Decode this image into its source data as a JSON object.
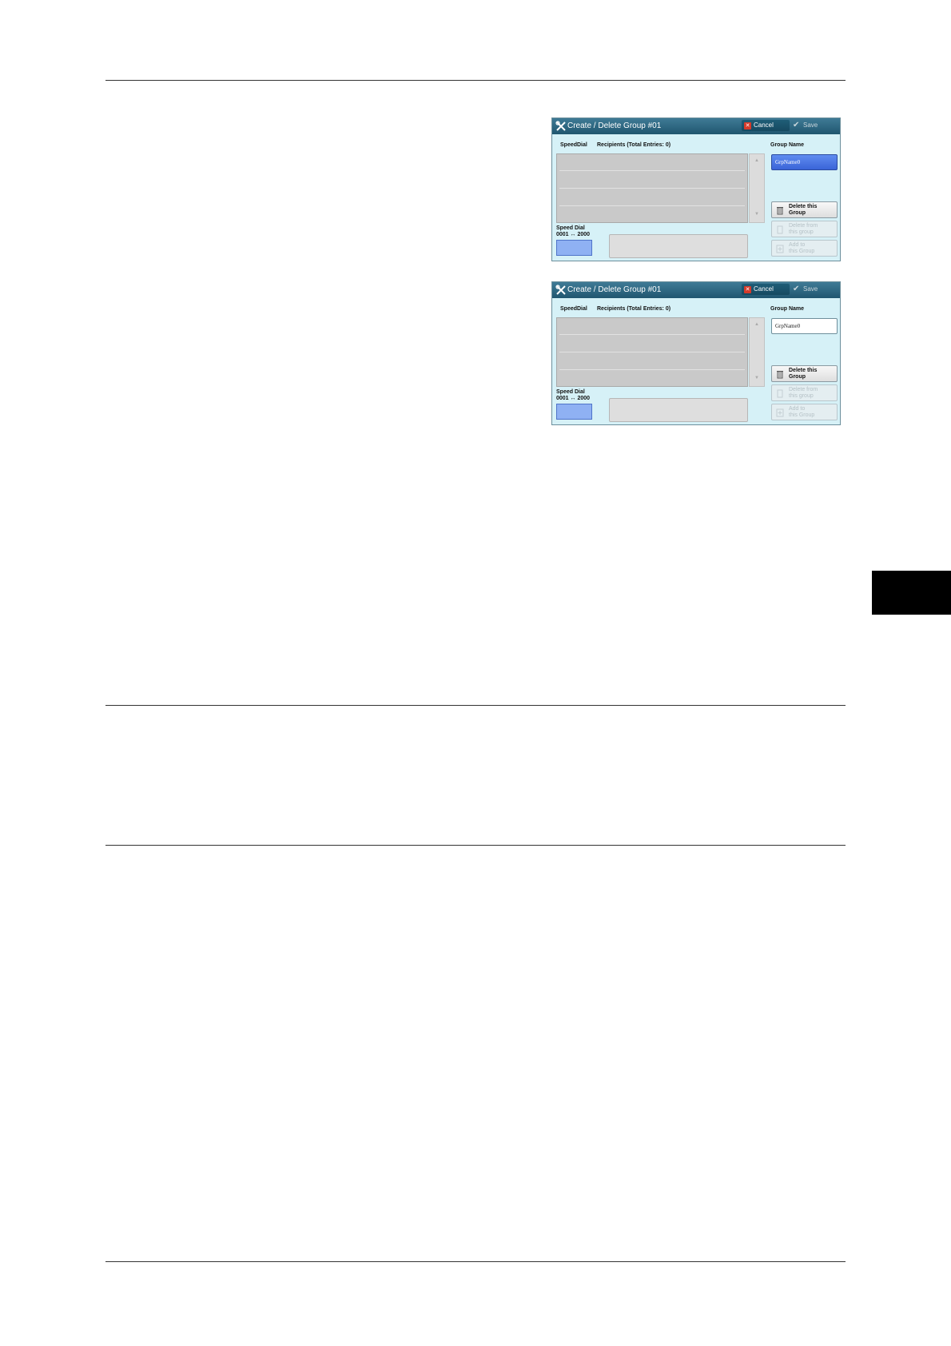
{
  "screens": [
    {
      "title": "Create / Delete Group #01",
      "cancel_label": "Cancel",
      "save_label": "Save",
      "col_speeddial": "SpeedDial",
      "col_recipients": "Recipients (Total Entries: 0)",
      "group_name_label": "Group Name",
      "group_name_value": "GrpName0",
      "delete_group": [
        "Delete this",
        "Group"
      ],
      "delete_from_group": [
        "Delete from",
        "this group"
      ],
      "add_to_group": [
        "Add to",
        "this Group"
      ],
      "speed_dial_label": [
        "Speed Dial",
        "0001 ↔ 2000"
      ]
    },
    {
      "title": "Create / Delete Group #01",
      "cancel_label": "Cancel",
      "save_label": "Save",
      "col_speeddial": "SpeedDial",
      "col_recipients": "Recipients (Total Entries: 0)",
      "group_name_label": "Group Name",
      "group_name_value": "GrpName0",
      "delete_group": [
        "Delete this",
        "Group"
      ],
      "delete_from_group": [
        "Delete from",
        "this group"
      ],
      "add_to_group": [
        "Add to",
        "this Group"
      ],
      "speed_dial_label": [
        "Speed Dial",
        "0001 ↔ 2000"
      ]
    }
  ]
}
